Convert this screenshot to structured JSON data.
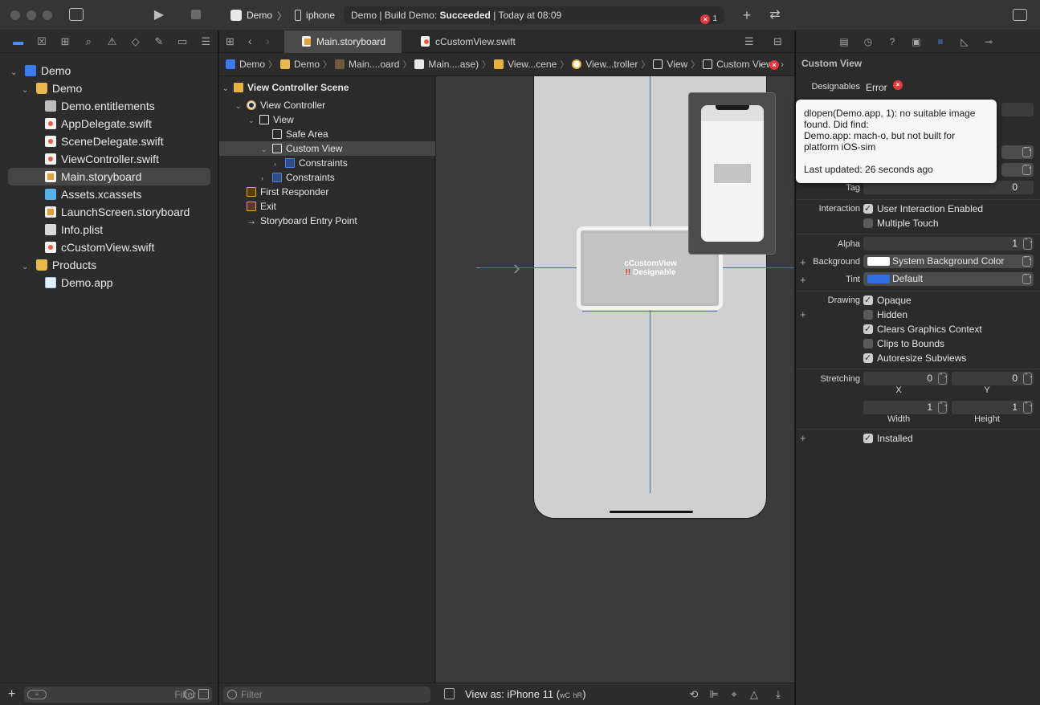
{
  "toolbar": {
    "scheme_app": "Demo",
    "scheme_device": "iphone",
    "activity_prefix": "Demo | Build Demo: ",
    "activity_status": "Succeeded",
    "activity_time": " | Today at 08:09",
    "error_count": "1",
    "icons": [
      "sidebar-toggle-icon",
      "run-icon",
      "stop-icon",
      "add-icon",
      "swap-icon",
      "inspector-toggle-icon"
    ]
  },
  "navigator": {
    "tree": [
      {
        "label": "Demo",
        "icon": "project-icon",
        "chevron": "⌄"
      },
      {
        "label": "Demo",
        "icon": "folder-icon",
        "chevron": "⌄"
      },
      {
        "label": "Demo.entitlements",
        "icon": "entitlements-icon"
      },
      {
        "label": "AppDelegate.swift",
        "icon": "swift-file-icon"
      },
      {
        "label": "SceneDelegate.swift",
        "icon": "swift-file-icon"
      },
      {
        "label": "ViewController.swift",
        "icon": "swift-file-icon"
      },
      {
        "label": "Main.storyboard",
        "icon": "storyboard-icon",
        "selected": true
      },
      {
        "label": "Assets.xcassets",
        "icon": "assets-icon"
      },
      {
        "label": "LaunchScreen.storyboard",
        "icon": "storyboard-icon"
      },
      {
        "label": "Info.plist",
        "icon": "plist-icon"
      },
      {
        "label": "cCustomView.swift",
        "icon": "swift-file-icon"
      },
      {
        "label": "Products",
        "icon": "folder-icon",
        "chevron": "⌄"
      },
      {
        "label": "Demo.app",
        "icon": "app-icon"
      }
    ],
    "filter_placeholder": "Filter"
  },
  "editor": {
    "tabs": [
      {
        "label": "Main.storyboard",
        "active": true
      },
      {
        "label": "cCustomView.swift",
        "active": false
      }
    ],
    "jumpbar": [
      "Demo",
      "Demo",
      "Main....oard",
      "Main....ase)",
      "View...cene",
      "View...troller",
      "View",
      "Custom View"
    ],
    "outline": [
      {
        "label": "View Controller Scene",
        "bold": true,
        "chevron": "⌄"
      },
      {
        "label": "View Controller",
        "chevron": "⌄"
      },
      {
        "label": "View",
        "chevron": "⌄"
      },
      {
        "label": "Safe Area"
      },
      {
        "label": "Custom View",
        "chevron": "⌄",
        "selected": true
      },
      {
        "label": "Constraints",
        "chevron": "›"
      },
      {
        "label": "Constraints",
        "chevron": "›"
      },
      {
        "label": "First Responder"
      },
      {
        "label": "Exit"
      },
      {
        "label": "Storyboard Entry Point"
      }
    ],
    "canvas": {
      "custom_view_name": "cCustomView",
      "custom_view_status": "Designable",
      "custom_view_warning": "!!"
    },
    "outline_filter_placeholder": "Filter",
    "view_as": "View as: iPhone 11 (",
    "view_as_w": "wC",
    "view_as_h": "hR",
    "view_as_end": ")"
  },
  "inspector": {
    "title": "Custom View",
    "designables_label": "Designables",
    "designables_value": "Error",
    "tooltip": {
      "message": "dlopen(Demo.app, 1): no suitable image found.  Did find:\n        Demo.app: mach-o, but not built for platform iOS-sim",
      "updated": "Last updated: 26 seconds ago"
    },
    "tag_label": "Tag",
    "tag_value": "0",
    "interaction_label": "Interaction",
    "user_interaction": "User Interaction Enabled",
    "multiple_touch": "Multiple Touch",
    "alpha_label": "Alpha",
    "alpha_value": "1",
    "background_label": "Background",
    "background_value": "System Background Color",
    "tint_label": "Tint",
    "tint_value": "Default",
    "drawing_label": "Drawing",
    "opaque": "Opaque",
    "hidden": "Hidden",
    "clears_graphics": "Clears Graphics Context",
    "clips_to_bounds": "Clips to Bounds",
    "autoresize": "Autoresize Subviews",
    "stretching_label": "Stretching",
    "stretch_x": "0",
    "stretch_y": "0",
    "x_label": "X",
    "y_label": "Y",
    "stretch_w": "1",
    "stretch_h": "1",
    "width_label": "Width",
    "height_label": "Height",
    "installed": "Installed",
    "colors": {
      "background": "#ffffff",
      "tint": "#2f6fe0",
      "error": "#e0383e"
    }
  }
}
